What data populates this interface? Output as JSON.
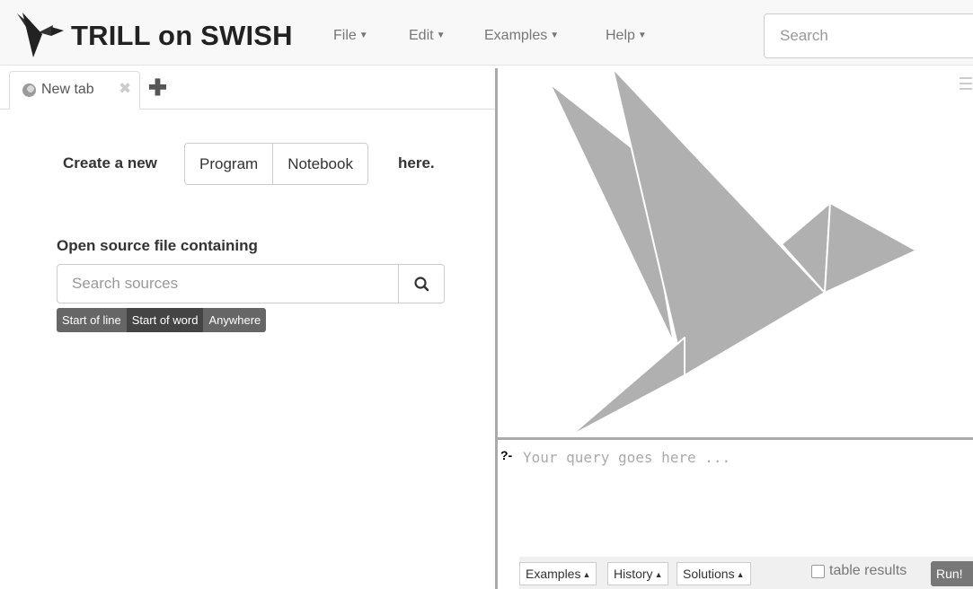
{
  "app": {
    "title": "TRILL on SWISH",
    "menus": [
      {
        "label": "File"
      },
      {
        "label": "Edit"
      },
      {
        "label": "Examples"
      },
      {
        "label": "Help"
      }
    ],
    "search_placeholder": "Search"
  },
  "tabs": [
    {
      "label": "New tab",
      "icon": "swish-tab-icon"
    }
  ],
  "new_tab": {
    "create_label": "Create a new",
    "program_button": "Program",
    "notebook_button": "Notebook",
    "here_label": "here.",
    "open_label": "Open source file containing",
    "source_search_placeholder": "Search sources",
    "filters": [
      "Start of line",
      "Start of word",
      "Anywhere"
    ],
    "active_filter": "Start of word"
  },
  "query": {
    "prompt": "?-",
    "placeholder": "Your query goes here ...",
    "buttons": [
      "Examples",
      "History",
      "Solutions"
    ],
    "table_results_label": "table results",
    "table_results_checked": false,
    "run_label": "Run!"
  },
  "colors": {
    "navbar_bg": "#f8f8f8",
    "bird_gray": "#b0b0b0",
    "logo_dark": "#333333",
    "filter_bg": "#666666"
  }
}
